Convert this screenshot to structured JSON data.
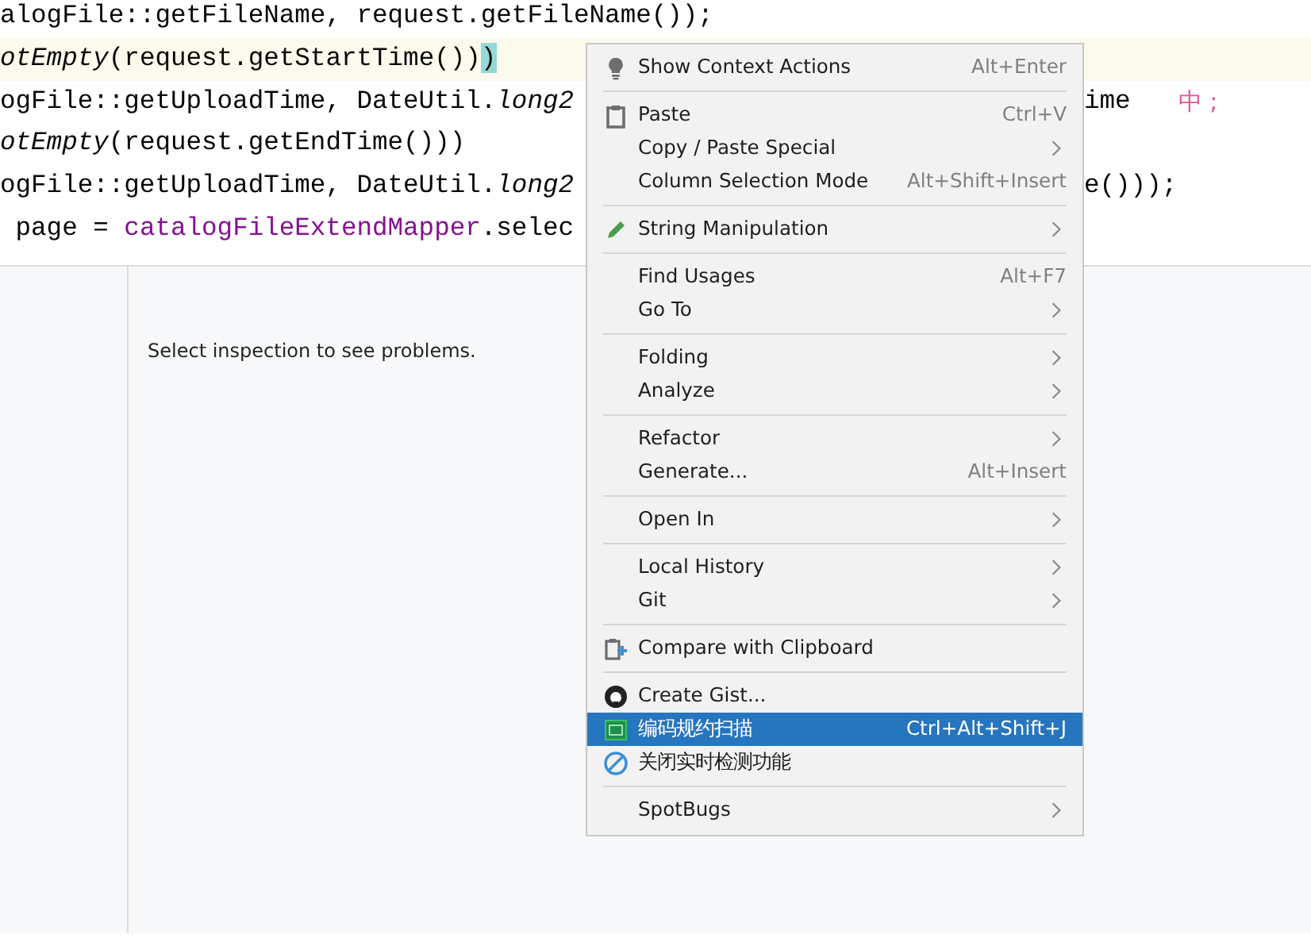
{
  "editor": {
    "lines": [
      {
        "current": false,
        "left": [
          {
            "kind": "plain",
            "text": "alogFile::getFileName, request.getFileName());"
          }
        ]
      },
      {
        "current": true,
        "left": [
          {
            "kind": "italic",
            "text": "otEmpty"
          },
          {
            "kind": "plain",
            "text": "(request.getStartTime())"
          },
          {
            "kind": "match",
            "text": ")"
          }
        ]
      },
      {
        "current": false,
        "left": [
          {
            "kind": "plain",
            "text": "ogFile::getUploadTime, DateUtil."
          },
          {
            "kind": "italic",
            "text": "long2"
          }
        ],
        "right": [
          {
            "kind": "plain",
            "text": "ime"
          }
        ],
        "ime": "中 ;"
      },
      {
        "current": false,
        "left": [
          {
            "kind": "italic",
            "text": "otEmpty"
          },
          {
            "kind": "plain",
            "text": "(request.getEndTime()))"
          }
        ]
      },
      {
        "current": false,
        "left": [
          {
            "kind": "plain",
            "text": "ogFile::getUploadTime, DateUtil."
          },
          {
            "kind": "italic",
            "text": "long2"
          }
        ],
        "right": [
          {
            "kind": "plain",
            "text": "e()));"
          }
        ]
      },
      {
        "current": false,
        "left": [
          {
            "kind": "plain",
            "text": " page = "
          },
          {
            "kind": "field",
            "text": "catalogFileExtendMapper"
          },
          {
            "kind": "plain",
            "text": ".selec"
          }
        ]
      }
    ]
  },
  "problems_panel": {
    "message": "Select inspection to see problems."
  },
  "context_menu": {
    "groups": [
      {
        "items": [
          {
            "label": "Show Context Actions",
            "shortcut": "Alt+Enter",
            "submenu": false,
            "selected": false
          }
        ]
      },
      {
        "items": [
          {
            "label": "Paste",
            "shortcut": "Ctrl+V",
            "submenu": false,
            "selected": false
          },
          {
            "label": "Copy / Paste Special",
            "submenu": true,
            "selected": false
          },
          {
            "label": "Column Selection Mode",
            "shortcut": "Alt+Shift+Insert",
            "submenu": false,
            "selected": false
          }
        ]
      },
      {
        "items": [
          {
            "label": "String Manipulation",
            "submenu": true,
            "selected": false
          }
        ]
      },
      {
        "items": [
          {
            "label": "Find Usages",
            "shortcut": "Alt+F7",
            "submenu": false,
            "selected": false
          },
          {
            "label": "Go To",
            "submenu": true,
            "selected": false
          }
        ]
      },
      {
        "items": [
          {
            "label": "Folding",
            "submenu": true,
            "selected": false
          },
          {
            "label": "Analyze",
            "submenu": true,
            "selected": false
          }
        ]
      },
      {
        "items": [
          {
            "label": "Refactor",
            "submenu": true,
            "selected": false
          },
          {
            "label": "Generate...",
            "shortcut": "Alt+Insert",
            "submenu": false,
            "selected": false
          }
        ]
      },
      {
        "items": [
          {
            "label": "Open In",
            "submenu": true,
            "selected": false
          }
        ]
      },
      {
        "items": [
          {
            "label": "Local History",
            "submenu": true,
            "selected": false
          },
          {
            "label": "Git",
            "submenu": true,
            "selected": false
          }
        ]
      },
      {
        "items": [
          {
            "label": "Compare with Clipboard",
            "submenu": false,
            "selected": false
          }
        ]
      },
      {
        "items": [
          {
            "label": "Create Gist...",
            "submenu": false,
            "selected": false
          },
          {
            "label": "编码规约扫描",
            "shortcut": "Ctrl+Alt+Shift+J",
            "submenu": false,
            "selected": true
          },
          {
            "label": "关闭实时检测功能",
            "submenu": false,
            "selected": false
          }
        ]
      },
      {
        "items": [
          {
            "label": "SpotBugs",
            "submenu": true,
            "selected": false
          }
        ]
      }
    ]
  }
}
